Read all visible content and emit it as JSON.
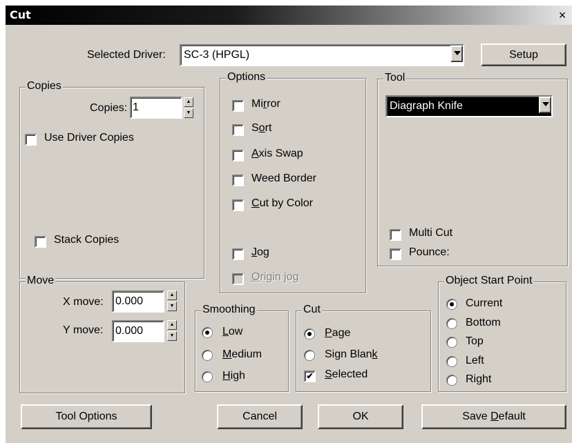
{
  "window": {
    "title": "Cut",
    "close_glyph": "×"
  },
  "driver": {
    "label": "Selected Driver:",
    "value": "SC-3 (HPGL)",
    "setup_label": "Setup"
  },
  "copies": {
    "group_title": "Copies",
    "copies_label": "Copies:",
    "copies_value": "1",
    "use_driver_copies": {
      "label": "Use Driver Copies",
      "checked": false
    },
    "stack_copies": {
      "label": "Stack Copies",
      "checked": false
    }
  },
  "move": {
    "group_title": "Move",
    "x_label": "X move:",
    "x_value": "0.000",
    "y_label": "Y move:",
    "y_value": "0.000"
  },
  "options": {
    "group_title": "Options",
    "items": [
      {
        "pre": "Mi",
        "ul": "r",
        "post": "ror",
        "checked": false
      },
      {
        "pre": "S",
        "ul": "o",
        "post": "rt",
        "checked": false
      },
      {
        "pre": "",
        "ul": "A",
        "post": "xis Swap",
        "checked": false
      },
      {
        "pre": "Weed Border",
        "ul": "",
        "post": "",
        "checked": false
      },
      {
        "pre": "",
        "ul": "C",
        "post": "ut by Color",
        "checked": false
      },
      {
        "pre": "",
        "ul": "J",
        "post": "og",
        "checked": false
      },
      {
        "pre": "",
        "ul": "O",
        "post": "rigin jog",
        "checked": false,
        "disabled": true
      }
    ]
  },
  "tool": {
    "group_title": "Tool",
    "selected": "Diagraph Knife",
    "multi_cut": {
      "label": "Multi Cut",
      "checked": false
    },
    "pounce": {
      "label": "Pounce:",
      "checked": false
    }
  },
  "smoothing": {
    "group_title": "Smoothing",
    "options": [
      {
        "pre": "",
        "ul": "L",
        "post": "ow",
        "selected": true
      },
      {
        "pre": "",
        "ul": "M",
        "post": "edium",
        "selected": false
      },
      {
        "pre": "",
        "ul": "H",
        "post": "igh",
        "selected": false
      }
    ]
  },
  "cut": {
    "group_title": "Cut",
    "page": {
      "pre": "",
      "ul": "P",
      "post": "age",
      "selected": true
    },
    "sign_blank": {
      "pre": "Sign Blan",
      "ul": "k",
      "post": "",
      "selected": false
    },
    "selected_chk": {
      "pre": "",
      "ul": "S",
      "post": "elected",
      "checked": true
    }
  },
  "start_point": {
    "group_title": "Object Start Point",
    "options": [
      {
        "label": "Current",
        "selected": true
      },
      {
        "label": "Bottom",
        "selected": false
      },
      {
        "label": "Top",
        "selected": false
      },
      {
        "label": "Left",
        "selected": false
      },
      {
        "label": "Right",
        "selected": false
      }
    ]
  },
  "buttons": {
    "tool_options": "Tool Options",
    "cancel": "Cancel",
    "ok": "OK",
    "save_default_pre": "Save ",
    "save_default_ul": "D",
    "save_default_post": "efault"
  },
  "check_mark": "✔"
}
